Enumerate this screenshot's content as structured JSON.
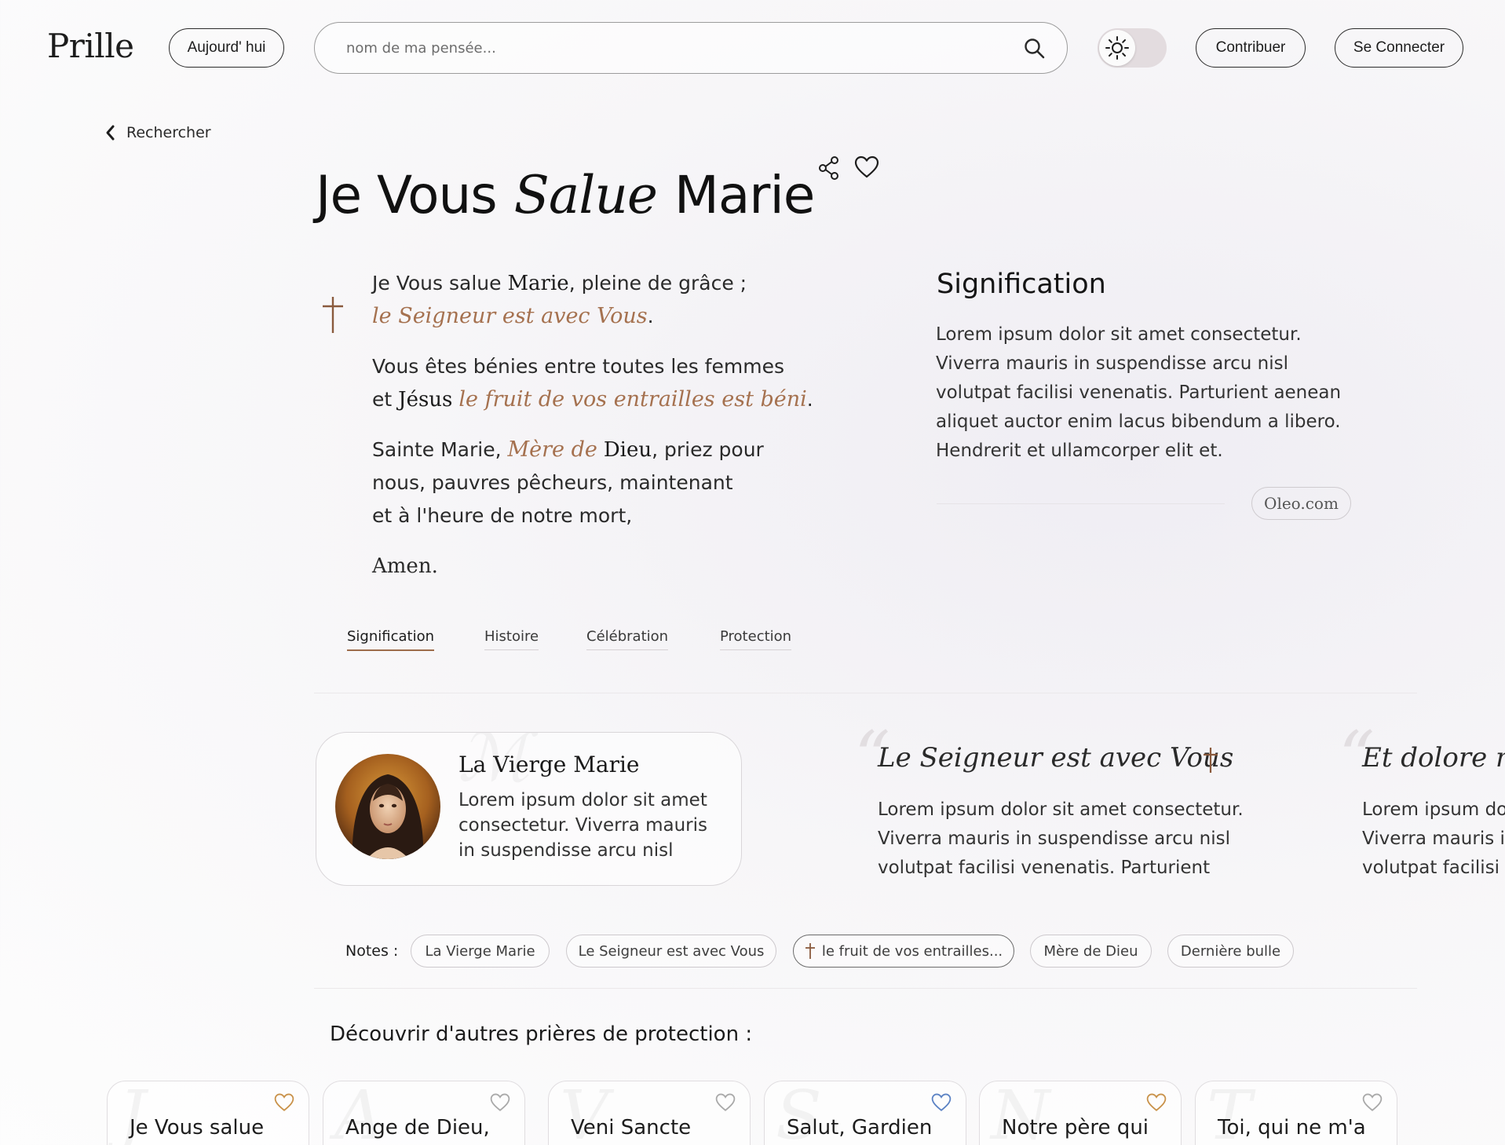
{
  "header": {
    "logo": "Prille",
    "today_label": "Aujourd' hui",
    "search_placeholder": "nom de ma pensée...",
    "contribute_label": "Contribuer",
    "login_label": "Se Connecter"
  },
  "back_label": "Rechercher",
  "title": {
    "part1": "Je Vous",
    "part2": "Salue",
    "part3": "Marie"
  },
  "prayer": {
    "l1a": "Je Vous salue ",
    "l1b": "Marie",
    "l1c": ", pleine de grâce ;",
    "l2": "le Seigneur est avec Vous",
    "l2end": ".",
    "l3": "Vous êtes bénies entre toutes les femmes",
    "l4a": "et ",
    "l4b": "Jésus",
    "l4c": " ",
    "l4d": "le fruit de vos entrailles est béni",
    "l4e": ".",
    "l5a": "Sainte Marie, ",
    "l5b": "Mère de",
    "l5c": " ",
    "l5d": "Dieu",
    "l5e": ", priez pour",
    "l6": "nous, pauvres pêcheurs, maintenant",
    "l7": "et à l'heure de notre mort,",
    "amen": "Amen."
  },
  "signification": {
    "title": "Signification",
    "text": "Lorem ipsum dolor sit amet consectetur. Viverra mauris in suspendisse arcu nisl volutpat facilisi venenatis. Parturient aenean aliquet auctor enim lacus bibendum a libero. Hendrerit et ullamcorper elit et.",
    "source": "Oleo.com"
  },
  "tabs": [
    {
      "label": "Signification"
    },
    {
      "label": "Histoire"
    },
    {
      "label": "Célébration"
    },
    {
      "label": "Protection"
    }
  ],
  "saint_card": {
    "name": "La Vierge Marie",
    "description": "Lorem ipsum dolor sit amet consectetur. Viverra mauris in suspendisse arcu nisl"
  },
  "quotes": [
    {
      "title": "Le Seigneur est avec Vous",
      "line1": "Lorem ipsum dolor sit amet consectetur.",
      "line2": "Viverra mauris in suspendisse arcu nisl",
      "line3": "volutpat facilisi venenatis. Parturient"
    },
    {
      "title": "Et dolore ma",
      "line1": "Lorem ipsum do",
      "line2": "Viverra mauris i",
      "line3": "volutpat facilisi"
    }
  ],
  "notes": {
    "label": "Notes :",
    "items": [
      "La Vierge Marie",
      "Le Seigneur est avec Vous",
      "le fruit de vos entrailles...",
      "Mère de Dieu",
      "Dernière bulle"
    ]
  },
  "discover": {
    "title": "Découvrir d'autres prières de protection :",
    "cards": [
      {
        "title": "Je Vous salue",
        "heart_color": "#c9924a"
      },
      {
        "title": "Ange de Dieu,",
        "heart_color": "#a9a9a9"
      },
      {
        "title": "Veni Sancte",
        "heart_color": "#a9a9a9"
      },
      {
        "title": "Salut, Gardien",
        "heart_color": "#5b82c4"
      },
      {
        "title": "Notre père qui",
        "heart_color": "#c9924a"
      },
      {
        "title": "Toi, qui ne m'a",
        "heart_color": "#a9a9a9"
      }
    ]
  },
  "colors": {
    "accent": "#a5714f",
    "tab_underline": "#9d6c4b",
    "text": "#1d1d1d"
  },
  "icons": [
    "search-icon",
    "sun-icon",
    "chevron-left-icon",
    "share-icon",
    "heart-icon",
    "cross-icon"
  ]
}
